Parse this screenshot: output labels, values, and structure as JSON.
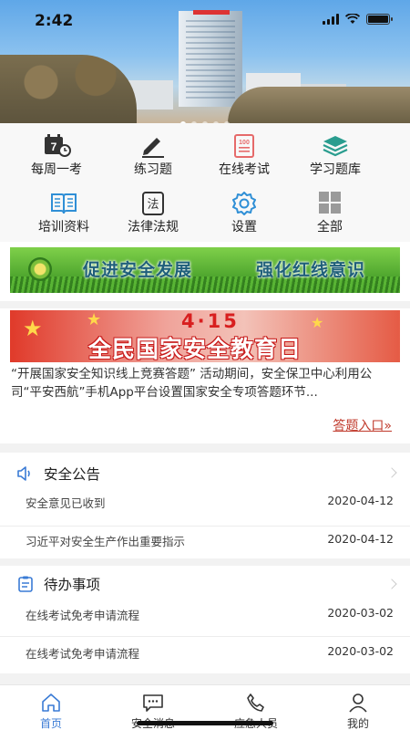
{
  "status_bar": {
    "time": "2:42"
  },
  "hero": {
    "carousel_dots": 5,
    "active_index": 0
  },
  "menu": [
    {
      "label": "每周一考",
      "icon": "calendar-7-icon",
      "color": "#333333"
    },
    {
      "label": "练习题",
      "icon": "pencil-icon",
      "color": "#333333"
    },
    {
      "label": "在线考试",
      "icon": "exam-paper-icon",
      "color": "#e66a6a"
    },
    {
      "label": "学习题库",
      "icon": "layers-icon",
      "color": "#2a9d8f"
    },
    {
      "label": "培训资料",
      "icon": "book-icon",
      "color": "#2f8fd6"
    },
    {
      "label": "法律法规",
      "icon": "law-icon",
      "color": "#333333"
    },
    {
      "label": "设置",
      "icon": "gear-icon",
      "color": "#2f8fd6"
    },
    {
      "label": "全部",
      "icon": "grid-icon",
      "color": "#888888"
    }
  ],
  "banner_slogan": {
    "left": "促进安全发展",
    "right": "强化红线意识"
  },
  "feature_banner": {
    "date": "4·15",
    "title": "全民国家安全教育日"
  },
  "feature_text": "“开展国家安全知识线上竞赛答题” 活动期间，安全保卫中心利用公司“平安西航”手机App平台设置国家安全专项答题环节...",
  "feature_link": "答题入口»",
  "announcements": {
    "title": "安全公告",
    "items": [
      {
        "text": "安全意见已收到",
        "date": "2020-04-12"
      },
      {
        "text": "习近平对安全生产作出重要指示",
        "date": "2020-04-12"
      }
    ]
  },
  "todos": {
    "title": "待办事项",
    "items": [
      {
        "text": "在线考试免考申请流程",
        "date": "2020-03-02"
      },
      {
        "text": "在线考试免考申请流程",
        "date": "2020-03-02"
      }
    ]
  },
  "tabbar": [
    {
      "label": "首页",
      "icon": "home-icon",
      "active": true
    },
    {
      "label": "安全消息",
      "icon": "message-icon",
      "active": false
    },
    {
      "label": "应急人员",
      "icon": "phone-icon",
      "active": false
    },
    {
      "label": "我的",
      "icon": "person-icon",
      "active": false
    }
  ],
  "colors": {
    "accent": "#3a7bd5",
    "link": "#c0392b"
  }
}
